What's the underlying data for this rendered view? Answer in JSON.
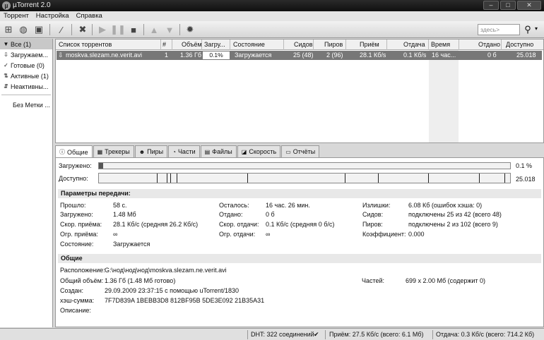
{
  "window": {
    "title": "µTorrent 2.0",
    "buttons": [
      "–",
      "□",
      "✕"
    ]
  },
  "menu": [
    "Торрент",
    "Настройка",
    "Справка"
  ],
  "search": {
    "placeholder": "здесь>"
  },
  "sidebar": {
    "items": [
      {
        "label": "Все (1)",
        "icon": "▼"
      },
      {
        "label": "Загружаем...",
        "icon": "⇩"
      },
      {
        "label": "Готовые (0)",
        "icon": "✓"
      },
      {
        "label": "Активные (1)",
        "icon": "⇅"
      },
      {
        "label": "Неактивны...",
        "icon": "⇵"
      }
    ],
    "labels_item": "Без Метки ..."
  },
  "torrent_list": {
    "columns": [
      "Список торрентов",
      "#",
      "Объём",
      "Загру...",
      "Состояние",
      "Сидов",
      "Пиров",
      "Приём",
      "Отдача",
      "Время",
      "Отдано",
      "Доступно"
    ],
    "rows": [
      {
        "name": "moskva.slezam.ne.verit.avi",
        "num": "1",
        "size": "1.36 Гб",
        "done": "0.1%",
        "progress": 0.1,
        "status": "Загружается",
        "seeds": "25 (48)",
        "peers": "2 (96)",
        "down": "28.1 Кб/s",
        "up": "0.1 Кб/s",
        "eta": "16 час...",
        "uploaded": "0 б",
        "avail": "25.018"
      }
    ]
  },
  "tabs": [
    "Общие",
    "Трекеры",
    "Пиры",
    "Части",
    "Файлы",
    "Скорость",
    "Отчёты"
  ],
  "bars": {
    "downloaded_label": "Загружено:",
    "downloaded_val": "0.1 %",
    "downloaded_fraction": 0.001,
    "available_label": "Доступно:",
    "available_val": "25.018"
  },
  "transfer": {
    "title": "Параметры передачи:",
    "elapsed_k": "Прошло:",
    "elapsed_v": "58 с.",
    "downloaded_k": "Загружено:",
    "downloaded_v": "1.48 Мб",
    "dlspeed_k": "Скор. приёма:",
    "dlspeed_v": "28.1 Кб/с (средняя 26.2 Кб/с)",
    "dllimit_k": "Огр. приёма:",
    "dllimit_v": "∞",
    "state_k": "Состояние:",
    "state_v": "Загружается",
    "remaining_k": "Осталось:",
    "remaining_v": "16 час. 26 мин.",
    "uploaded_k": "Отдано:",
    "uploaded_v": "0 б",
    "ulspeed_k": "Скор. отдачи:",
    "ulspeed_v": "0.1 Кб/с (средняя 0 б/с)",
    "ullimit_k": "Огр. отдачи:",
    "ullimit_v": "∞",
    "wasted_k": "Излишки:",
    "wasted_v": "6.08 Кб (ошибок хэша: 0)",
    "seeds_k": "Сидов:",
    "seeds_v": "подключены 25 из 42 (всего 48)",
    "peers_k": "Пиров:",
    "peers_v": "подключены 2 из 102 (всего 9)",
    "ratio_k": "Коэффициент:",
    "ratio_v": "0.000"
  },
  "general": {
    "title": "Общие",
    "location_k": "Расположение:",
    "location_v": "G:\\нод\\нод\\нод\\moskva.slezam.ne.verit.avi",
    "size_k": "Общий объём:",
    "size_v": "1.36 Гб (1.48 Мб готово)",
    "pieces_k": "Частей:",
    "pieces_v": "699 x 2.00 Мб (содержит 0)",
    "created_k": "Создан:",
    "created_v": "29.09.2009 23:37:15 с помощью uTorrent/1830",
    "hash_k": "хэш-сумма:",
    "hash_v": "7F7D839A 1BEBB3D8 812BF95B 5DE3E092 21B35A31",
    "comment_k": "Описание:",
    "comment_v": ""
  },
  "status": {
    "dht": "DHT: 322 соединений",
    "down": "Приём: 27.5 Кб/с (всего: 6.1 Мб)",
    "up": "Отдача: 0.3 Кб/с (всего: 714.2 Кб)"
  }
}
